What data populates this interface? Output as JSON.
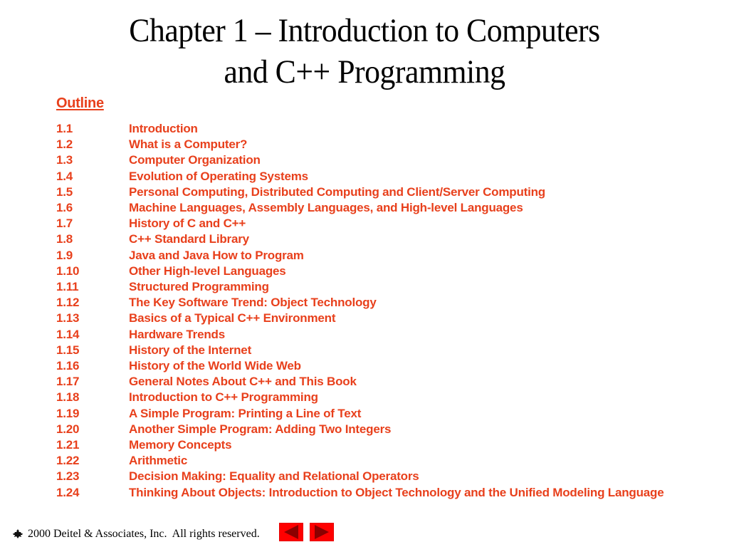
{
  "title": {
    "line1": "Chapter 1 – Introduction to Computers",
    "line2": "and C++ Programming"
  },
  "outline": {
    "heading": "Outline",
    "items": [
      {
        "num": "1.1",
        "text": "Introduction"
      },
      {
        "num": "1.2",
        "text": "What is a Computer?"
      },
      {
        "num": "1.3",
        "text": "Computer Organization"
      },
      {
        "num": "1.4",
        "text": "Evolution of Operating Systems"
      },
      {
        "num": "1.5",
        "text": "Personal Computing, Distributed Computing and Client/Server Computing"
      },
      {
        "num": "1.6",
        "text": "Machine Languages, Assembly Languages, and High-level Languages"
      },
      {
        "num": "1.7",
        "text": "History of C and C++"
      },
      {
        "num": "1.8",
        "text": "C++ Standard Library"
      },
      {
        "num": "1.9",
        "text": "Java and Java How to Program"
      },
      {
        "num": "1.10",
        "text": "Other High-level Languages"
      },
      {
        "num": "1.11",
        "text": "Structured Programming"
      },
      {
        "num": "1.12",
        "text": "The Key Software Trend: Object Technology"
      },
      {
        "num": "1.13",
        "text": "Basics of a Typical C++ Environment"
      },
      {
        "num": "1.14",
        "text": "Hardware Trends"
      },
      {
        "num": "1.15",
        "text": "History of the Internet"
      },
      {
        "num": "1.16",
        "text": "History of the World Wide Web"
      },
      {
        "num": "1.17",
        "text": "General Notes About C++ and This Book"
      },
      {
        "num": "1.18",
        "text": "Introduction to C++ Programming"
      },
      {
        "num": "1.19",
        "text": "A Simple Program: Printing a Line of Text"
      },
      {
        "num": "1.20",
        "text": "Another Simple Program: Adding Two Integers"
      },
      {
        "num": "1.21",
        "text": "Memory Concepts"
      },
      {
        "num": "1.22",
        "text": "Arithmetic"
      },
      {
        "num": "1.23",
        "text": "Decision Making: Equality and Relational Operators"
      },
      {
        "num": "1.24",
        "text": "Thinking About Objects: Introduction to Object Technology and the Unified Modeling Language"
      }
    ]
  },
  "footer": {
    "logo_icon": "deitel-bug-logo-icon",
    "copyright": "2000 Deitel & Associates, Inc.  All rights reserved.",
    "prev_icon": "left-triangle-icon",
    "next_icon": "right-triangle-icon"
  },
  "colors": {
    "accent": "#E8401C",
    "nav_button": "#FF0000",
    "nav_arrow": "#8B0000"
  }
}
